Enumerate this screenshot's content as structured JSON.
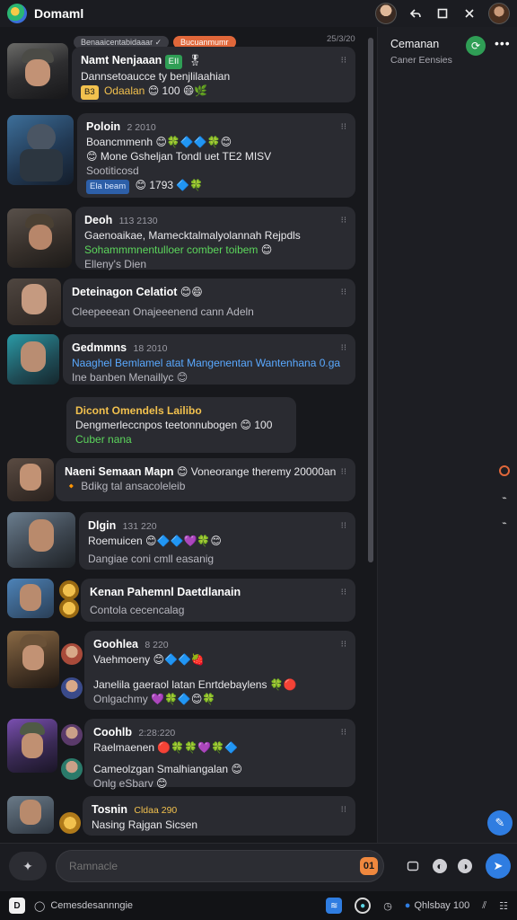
{
  "app": {
    "title": "Domaml",
    "logo_icon": "app-logo-icon"
  },
  "topbar": {
    "icons": [
      "profile-avatar",
      "reply-icon",
      "window-icon",
      "close-icon",
      "user-avatar"
    ]
  },
  "chat_header": {
    "pill_primary": "Benaaicentabidaaar",
    "pill_secondary": "Bucuanmumr",
    "date": "25/3/20"
  },
  "messages": [
    {
      "name": "Namt Nenjaaan",
      "badge": "EII",
      "line1": "Dannsetoaucce ty benjlilaahian",
      "tag": "B3",
      "line2": "Odaalan",
      "count": "100",
      "opts": "⁝⁝"
    },
    {
      "name": "Poloin",
      "time": "2 2010",
      "line1": "Boancmmenh",
      "line2": "Mone Gsheljan   Tondl uet TE2 MISV",
      "line3": "Sootiticosd",
      "tag": "Ela beam",
      "count": "1793",
      "opts": "⁝⁝"
    },
    {
      "name": "Deoh",
      "time": "113 2130",
      "line1": "Gaenoaikae, Mamecktalmalyolannah Rejpdls",
      "line2": "Sohammmnentulloer comber toibem",
      "line3": "Elleny's Dien",
      "opts": "⁝⁝"
    },
    {
      "name": "Deteinagon Celatiot",
      "line1": "Cleepeeean Onajeeenend cann Adeln",
      "opts": "⁝⁝"
    },
    {
      "name": "Gedmmns",
      "time": "18 2010",
      "line1": "Naaghel Bemlamel atat Mangenentan Wantenhana 0.ga",
      "line2": "Ine banben   Menaillyc",
      "opts": "⁝⁝"
    },
    {
      "name": "Dicont Omendels Lailibo",
      "line1": "Dengmerleccnpos teetonnubogen",
      "count": "100",
      "line2": "Cuber nana"
    },
    {
      "name": "Naeni Semaan Mapn",
      "line1": "Voneorange   theremy 20000an",
      "line2": "Bdikg tal ansacoleleib",
      "opts": "⁝⁝"
    },
    {
      "name": "Dlgin",
      "time": "131 220",
      "line1": "Roemuicen",
      "line2": "Dangiae coni cmll easanig",
      "opts": "⁝⁝"
    },
    {
      "name": "Kenan Pahemnl Daetdlanain",
      "line1": "Contola cecencalag",
      "opts": "⁝⁝"
    },
    {
      "name": "Goohlea",
      "time": "8 220",
      "line1": "Vaehmoeny",
      "line2": "Janelila gaeraol latan   Enrtdebaylens",
      "line3": "Onlgachmy",
      "opts": "⁝⁝"
    },
    {
      "name": "Coohlb",
      "time": "2:28:220",
      "line1": "Raelmaenen",
      "line2": "Cameolzgan   Smalhiangalan",
      "line3": "Onlg eSbarv",
      "opts": "⁝⁝"
    },
    {
      "name": "Tosnin",
      "time": "Cldaa 290",
      "line1": "Nasing Rajgan Sicsen",
      "opts": "⁝⁝"
    }
  ],
  "panel": {
    "title": "Cemanan",
    "subtitle": "Caner Eensies"
  },
  "composer": {
    "placeholder": "Ramnacle",
    "emoji_label": "01"
  },
  "taskbar": {
    "search_label": "Cemesdesannngie",
    "status_label": "Qhlsbay 100"
  }
}
